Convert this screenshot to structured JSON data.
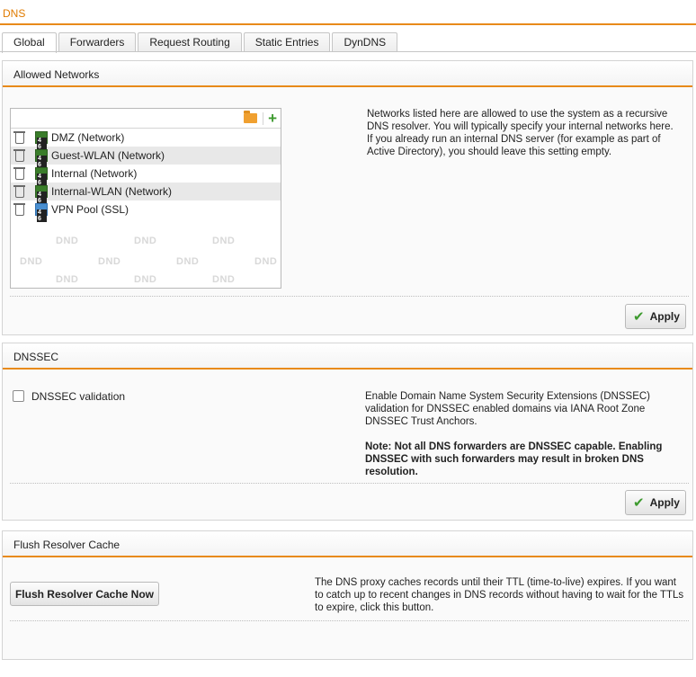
{
  "page": {
    "title": "DNS"
  },
  "tabs": [
    {
      "label": "Global"
    },
    {
      "label": "Forwarders"
    },
    {
      "label": "Request Routing"
    },
    {
      "label": "Static Entries"
    },
    {
      "label": "DynDNS"
    }
  ],
  "allowed_networks": {
    "title": "Allowed Networks",
    "items": [
      {
        "label": "DMZ (Network)",
        "icon": "network-icon"
      },
      {
        "label": "Guest-WLAN (Network)",
        "icon": "network-icon"
      },
      {
        "label": "Internal (Network)",
        "icon": "network-icon"
      },
      {
        "label": "Internal-WLAN (Network)",
        "icon": "network-icon"
      },
      {
        "label": "VPN Pool (SSL)",
        "icon": "vpn-pool-icon"
      }
    ],
    "watermark": "DND",
    "description": "Networks listed here are allowed to use the system as a recursive DNS resolver. You will typically specify your internal networks here. If you already run an internal DNS server (for example as part of Active Directory), you should leave this setting empty.",
    "apply_label": "Apply"
  },
  "dnssec": {
    "title": "DNSSEC",
    "checkbox_label": "DNSSEC validation",
    "checked": false,
    "description": "Enable Domain Name System Security Extensions (DNSSEC) validation for DNSSEC enabled domains via IANA Root Zone DNSSEC Trust Anchors.",
    "note": "Note: Not all DNS forwarders are DNSSEC capable. Enabling DNSSEC with such forwarders may result in broken DNS resolution.",
    "apply_label": "Apply"
  },
  "flush": {
    "title": "Flush Resolver Cache",
    "button_label": "Flush Resolver Cache Now",
    "description": "The DNS proxy caches records until their TTL (time-to-live) expires. If you want to catch up to recent changes in DNS records without having to wait for the TTLs to expire, click this button."
  },
  "colors": {
    "accent": "#e88a1a",
    "title": "#e07b00",
    "check_green": "#3d9a2e"
  }
}
